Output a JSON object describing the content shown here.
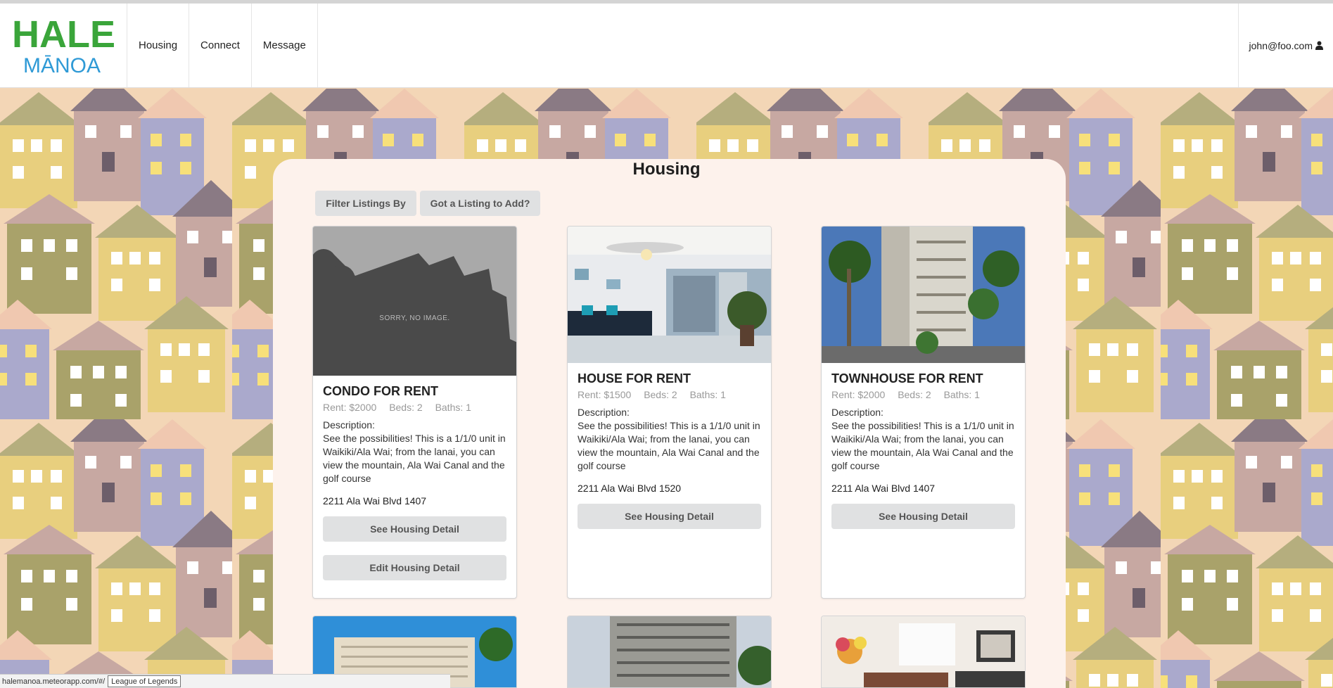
{
  "logo": {
    "top_text": "HALE",
    "bottom_text": "MĀNOA"
  },
  "nav": {
    "items": [
      {
        "label": "Housing"
      },
      {
        "label": "Connect"
      },
      {
        "label": "Message"
      }
    ],
    "user_email": "john@foo.com",
    "user_icon": "user-icon"
  },
  "page": {
    "title": "Housing",
    "filter_button": "Filter Listings By",
    "add_button": "Got a Listing to Add?"
  },
  "listings": [
    {
      "title": "CONDO FOR RENT",
      "rent": "Rent: $2000",
      "beds": "Beds: 2",
      "baths": "Baths: 1",
      "desc_label": "Description:",
      "description": "See the possibilities! This is a 1/1/0 unit in Waikiki/Ala Wai; from the lanai, you can view the mountain, Ala Wai Canal and the golf course",
      "address": "2211 Ala Wai Blvd 1407",
      "detail_button": "See Housing Detail",
      "edit_button": "Edit Housing Detail",
      "image_text": "SORRY, NO IMAGE."
    },
    {
      "title": "HOUSE FOR RENT",
      "rent": "Rent: $1500",
      "beds": "Beds: 2",
      "baths": "Baths: 1",
      "desc_label": "Description:",
      "description": "See the possibilities! This is a 1/1/0 unit in Waikiki/Ala Wai; from the lanai, you can view the mountain, Ala Wai Canal and the golf course",
      "address": "2211 Ala Wai Blvd 1520",
      "detail_button": "See Housing Detail"
    },
    {
      "title": "TOWNHOUSE FOR RENT",
      "rent": "Rent: $2000",
      "beds": "Beds: 2",
      "baths": "Baths: 1",
      "desc_label": "Description:",
      "description": "See the possibilities! This is a 1/1/0 unit in Waikiki/Ala Wai; from the lanai, you can view the mountain, Ala Wai Canal and the golf course",
      "address": "2211 Ala Wai Blvd 1407",
      "detail_button": "See Housing Detail"
    }
  ],
  "status": {
    "url": "halemanoa.meteorapp.com/#/",
    "tooltip": "League of Legends"
  },
  "colors": {
    "logo_green": "#3aa53a",
    "logo_blue": "#2f9ad6",
    "panel_bg": "#fdf2ec",
    "button_bg": "#e0e1e2"
  }
}
